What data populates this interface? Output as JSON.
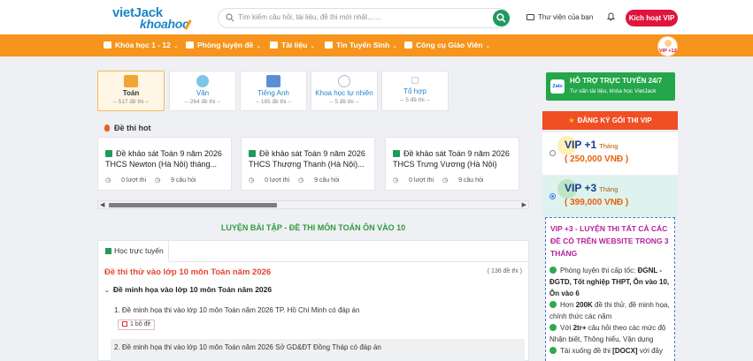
{
  "header": {
    "logo_top": "vietJack",
    "logo_bottom": "khoahoc",
    "search_placeholder": "Tìm kiếm câu hỏi, tài liệu, đề thi mới nhất.......",
    "library_label": "Thư viện của bạn",
    "vip_button": "Kích hoạt VIP"
  },
  "nav": {
    "items": [
      {
        "label": "Khóa học 1 - 12"
      },
      {
        "label": "Phòng luyện đề"
      },
      {
        "label": "Tài liệu"
      },
      {
        "label": "Tin Tuyển Sinh"
      },
      {
        "label": "Công cụ Giáo Viên"
      }
    ],
    "avatar_tag": "VIP +12"
  },
  "subjects": [
    {
      "name": "Toán",
      "count": "-- 517 đề thi --",
      "color": "#f2a533"
    },
    {
      "name": "Văn",
      "count": "-- 264 đề thi --",
      "color": "#7cc6e8"
    },
    {
      "name": "Tiếng Anh",
      "count": "-- 185 đề thi --",
      "color": "#5a8fd6"
    },
    {
      "name": "Khoa học tự nhiên",
      "count": "-- 5 đề thi --",
      "color": "#b7b7c9"
    },
    {
      "name": "Tổ hợp",
      "count": "-- 5 đề thi --",
      "color": "#e6e6e6"
    }
  ],
  "section_title": "Đề thi hot",
  "hot_exams": [
    {
      "title": "Đề khảo sát Toán 9 năm 2026 THCS Newton (Hà Nội) tháng...",
      "attempts": "0 lượt thi",
      "questions": "9 câu hỏi"
    },
    {
      "title": "Đề khảo sát Toán 9 năm 2026 THCS Thượng Thanh (Hà Nội)...",
      "attempts": "0 lượt thi",
      "questions": "9 câu hỏi"
    },
    {
      "title": "Đề khảo sát Toán 9 năm 2026 THCS Trưng Vương (Hà Nội) thán...",
      "attempts": "0 lượt thi",
      "questions": "9 câu hỏi"
    }
  ],
  "practice_heading": "LUYỆN BÀI TẬP - ĐỀ THI MÔN TOÁN ÔN VÀO 10",
  "tab_label": "Học trực tuyến",
  "exam_group": {
    "title": "Đề thi thử vào lớp 10 môn Toán năm 2026",
    "count": "( 136 đề thi )",
    "subgroup": "Đề minh họa vào lớp 10 môn Toán năm 2026",
    "entries": [
      "1. Đề minh họa thi vào lớp 10 môn Toán năm 2026 TP. Hồ Chí Minh có đáp án",
      "2. Đề minh họa thi vào lớp 10 môn Toán năm 2026 Sở GD&ĐT Đồng Tháp có đáp án"
    ],
    "badge": "1 bộ đề"
  },
  "sidebar": {
    "zalo_icon": "Zalo",
    "zalo_title": "HỖ TRỢ TRỰC TUYẾN 24/7",
    "zalo_sub": "Tư vấn tài liệu, khóa học VietJack",
    "register": "ĐĂNG KÝ GÓI THI VIP",
    "plans": [
      {
        "name": "VIP +1",
        "unit": "Tháng",
        "price": "( 250,000 VNĐ )",
        "selected": false
      },
      {
        "name": "VIP +3",
        "unit": "Tháng",
        "price": "( 399,000 VNĐ )",
        "selected": true
      }
    ],
    "vip_heading": "VIP +3 - LUYỆN THI TẤT CẢ CÁC ĐỀ CÓ TRÊN WEBSITE TRONG 3 THÁNG",
    "features": [
      {
        "pre": "Phòng luyện thi cấp tốc: ",
        "bold": "ĐGNL - ĐGTD, Tốt nghiệp THPT, Ôn vào 10, Ôn vào 6",
        "post": ""
      },
      {
        "pre": "Hơn ",
        "bold": "200K",
        "post": " đề thi thử, đề minh họa, chính thức các năm"
      },
      {
        "pre": "Với ",
        "bold": "2tr+",
        "post": " câu hỏi theo các mức độ Nhận biết, Thông hiểu, Vận dụng"
      },
      {
        "pre": "Tải xuống đề thi ",
        "bold": "[DOCX]",
        "post": " với đầy"
      }
    ]
  },
  "colors": {
    "orange": "#f7941d",
    "green": "#1f9a5d",
    "red": "#e0143c"
  }
}
